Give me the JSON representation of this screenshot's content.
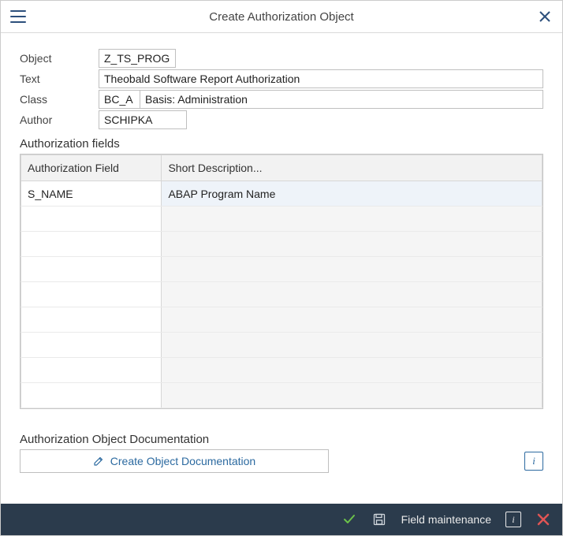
{
  "titlebar": {
    "title": "Create Authorization Object"
  },
  "form": {
    "object_label": "Object",
    "object_value": "Z_TS_PROG",
    "text_label": "Text",
    "text_value": "Theobald Software Report Authorization",
    "class_label": "Class",
    "class_code": "BC_A",
    "class_desc": "Basis: Administration",
    "author_label": "Author",
    "author_value": "SCHIPKA"
  },
  "auth_section": {
    "heading": "Authorization fields",
    "columns": {
      "field": "Authorization Field",
      "desc": "Short Description..."
    },
    "rows": [
      {
        "field": "S_NAME",
        "desc": "ABAP Program Name"
      }
    ]
  },
  "doc_section": {
    "heading": "Authorization Object Documentation",
    "button_label": "Create Object Documentation"
  },
  "footer": {
    "field_maintenance": "Field maintenance"
  }
}
